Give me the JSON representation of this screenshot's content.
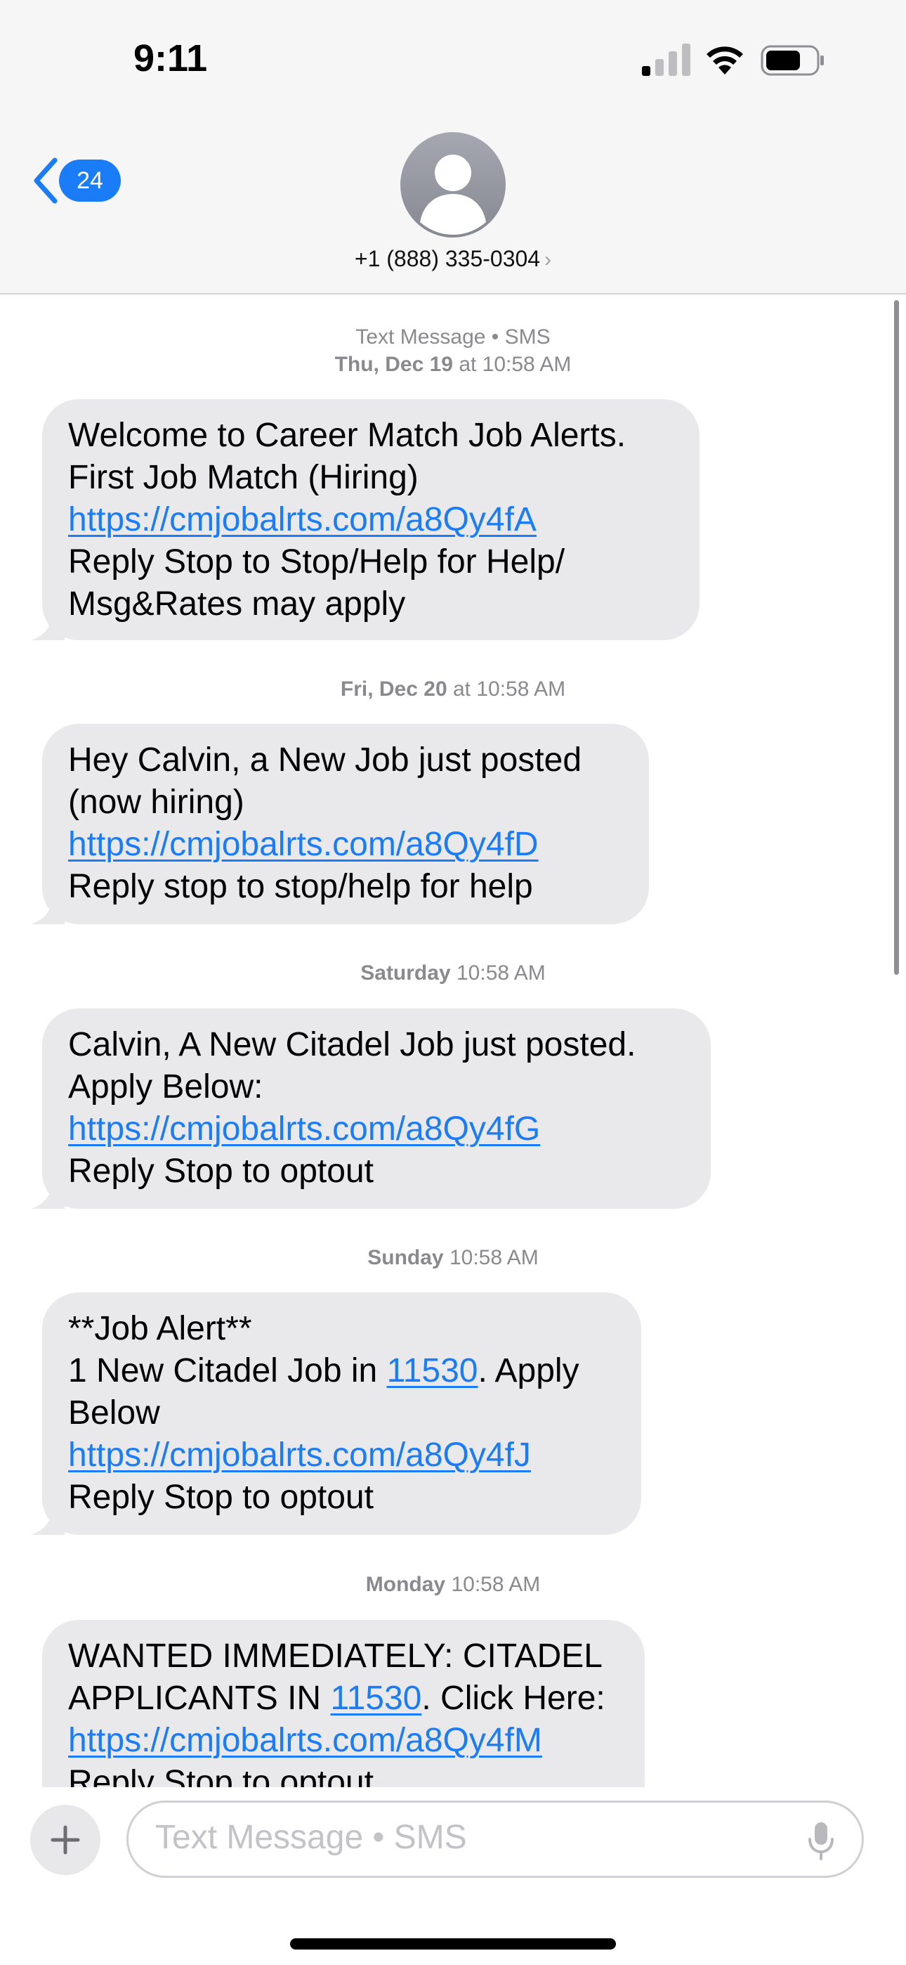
{
  "status_bar": {
    "time": "9:11"
  },
  "header": {
    "unread_count": "24",
    "contact": "+1 (888) 335-0304",
    "contact_chevron": "›"
  },
  "thread": {
    "service_label": "Text Message • SMS",
    "messages": [
      {
        "day": "Thu, Dec 19",
        "time": "at 10:58 AM",
        "lines": [
          "Welcome to Career Match Job Alerts.",
          "First Job Match (Hiring)",
          "https://cmjobalrts.com/a8Qy4fA",
          "Reply Stop to Stop/Help for Help/",
          "Msg&Rates may apply"
        ]
      },
      {
        "day": "Fri, Dec 20",
        "time": "at 10:58 AM",
        "lines": [
          "Hey Calvin, a New Job just posted",
          "(now hiring)",
          "https://cmjobalrts.com/a8Qy4fD",
          "Reply stop to stop/help for help"
        ]
      },
      {
        "day": "Saturday",
        "time": "10:58 AM",
        "lines": [
          "Calvin, A New Citadel Job just posted.",
          "Apply Below:",
          "https://cmjobalrts.com/a8Qy4fG",
          "Reply Stop to optout"
        ]
      },
      {
        "day": "Sunday",
        "time": "10:58 AM",
        "lines": [
          "**Job Alert**",
          "1 New Citadel Job in ",
          "11530",
          ". Apply",
          "Below",
          "https://cmjobalrts.com/a8Qy4fJ",
          "Reply Stop to optout"
        ]
      },
      {
        "day": "Monday",
        "time": "10:58 AM",
        "lines": [
          "WANTED IMMEDIATELY: CITADEL",
          "APPLICANTS IN ",
          "11530",
          ". Click Here:",
          "https://cmjobalrts.com/a8Qy4fM",
          "Reply Stop to optout"
        ]
      }
    ]
  },
  "composer": {
    "placeholder": "Text Message • SMS"
  },
  "colors": {
    "accent": "#1a7cf7",
    "bubble": "#e9e9eb",
    "timestamp": "#8a8a8e"
  },
  "icons": {
    "back": "chevron-left-icon",
    "avatar": "person-icon",
    "plus": "plus-icon",
    "mic": "microphone-icon",
    "signal": "cellular-signal-icon",
    "wifi": "wifi-icon",
    "battery": "battery-icon"
  }
}
